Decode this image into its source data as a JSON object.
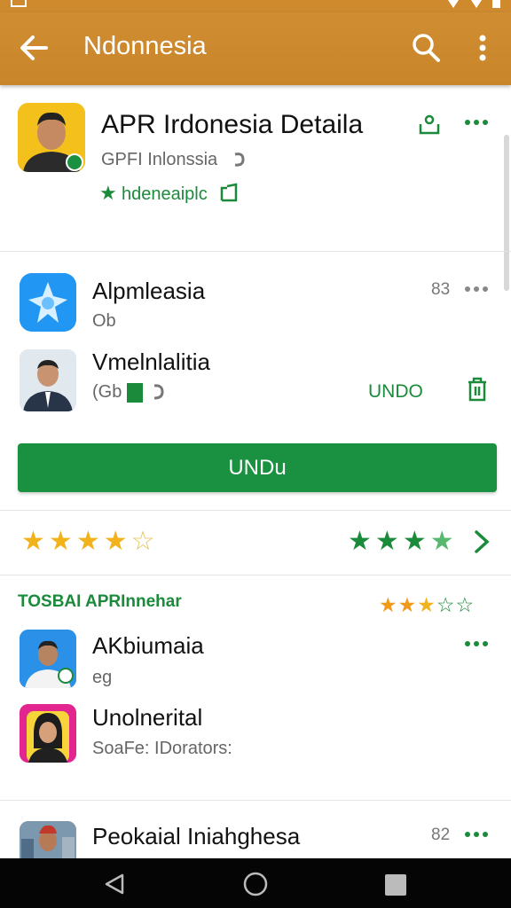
{
  "app_bar": {
    "title": "Ndonnesia"
  },
  "header_app": {
    "title": "APR Irdonesia Detaila",
    "developer": "GPFI Inlonssia",
    "badge_text": "hdeneaiplc"
  },
  "list1": [
    {
      "name": "Alpmleasia",
      "sub": "Ob",
      "count": "83"
    },
    {
      "name": "Vmelnlalitia",
      "sub": "(Gb",
      "action": "UNDO"
    }
  ],
  "primary_button": {
    "label": "UNDu"
  },
  "ratings_row": {
    "left_stars": 4,
    "right_stars": 3.5
  },
  "section": {
    "label": "TOSBAI APRInnehar",
    "label_rating": 3.5
  },
  "list2": [
    {
      "name": "AKbiumaia",
      "sub": "eg"
    },
    {
      "name": "Unolnerital",
      "sub": "SoaFe: IDorators:"
    },
    {
      "name": "Peokaial Iniahghesa",
      "count": "82"
    }
  ],
  "colors": {
    "app_bar": "#cf8a2e",
    "green": "#1b8a3b",
    "star_gold": "#f2b21b",
    "star_orange": "#f09a1c"
  }
}
